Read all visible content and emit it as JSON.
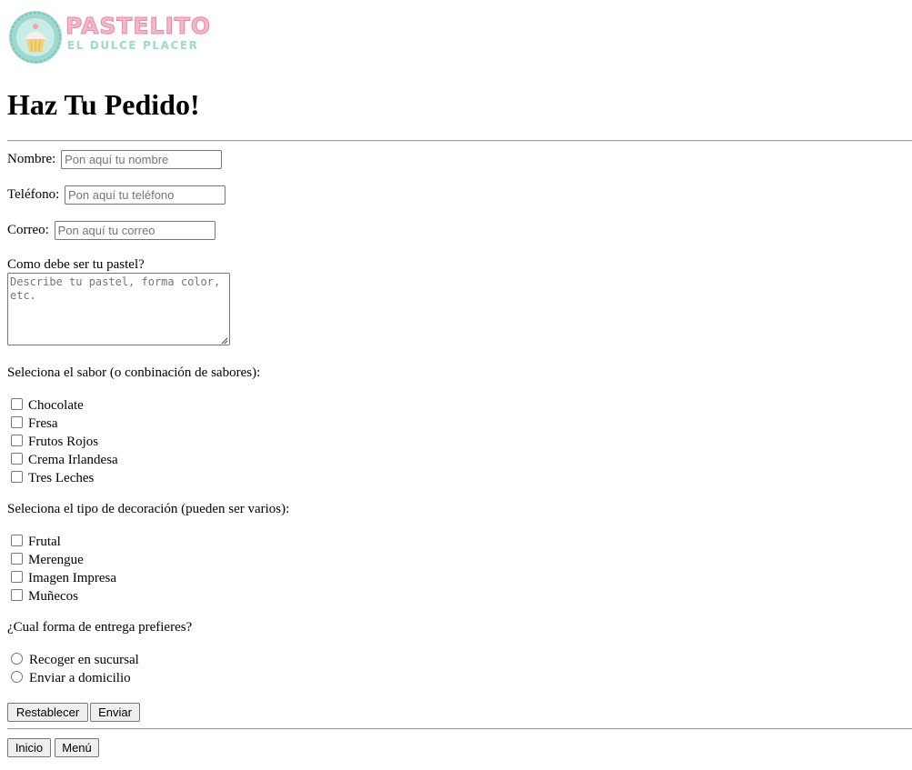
{
  "logo": {
    "brand": "PASTELITO",
    "tagline": "EL DULCE PLACER",
    "colors": {
      "pink": "#f7b7c8",
      "mint": "#9fd8cf"
    }
  },
  "heading": "Haz Tu Pedido!",
  "form": {
    "nombre": {
      "label": "Nombre:",
      "placeholder": "Pon aquí tu nombre"
    },
    "telefono": {
      "label": "Teléfono:",
      "placeholder": "Pon aquí tu teléfono"
    },
    "correo": {
      "label": "Correo:",
      "placeholder": "Pon aquí tu correo"
    },
    "pastel": {
      "label": "Como debe ser tu pastel?",
      "placeholder": "Describe tu pastel, forma color, etc."
    },
    "sabores": {
      "label": "Seleciona el sabor (o conbinación de sabores):",
      "options": [
        "Chocolate",
        "Fresa",
        "Frutos Rojos",
        "Crema Irlandesa",
        "Tres Leches"
      ]
    },
    "decoracion": {
      "label": "Seleciona el tipo de decoración (pueden ser varios):",
      "options": [
        "Frutal",
        "Merengue",
        "Imagen Impresa",
        "Muñecos"
      ]
    },
    "entrega": {
      "label": "¿Cual forma de entrega prefieres?",
      "options": [
        "Recoger en sucursal",
        "Enviar a domicilio"
      ]
    },
    "buttons": {
      "reset": "Restablecer",
      "submit": "Enviar"
    }
  },
  "nav": {
    "inicio": "Inicio",
    "menu": "Menú"
  }
}
